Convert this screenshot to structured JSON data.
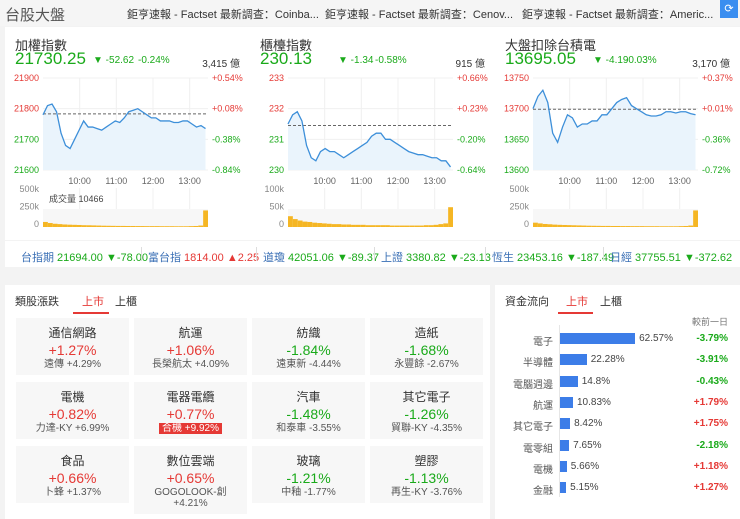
{
  "header": {
    "title": "台股大盤",
    "news": [
      "鉅亨速報 - Factset 最新調查：Coinba...",
      "鉅亨速報 - Factset 最新調查：Cenov...",
      "鉅亨速報 - Factset 最新調查：Americ..."
    ],
    "refresh_icon": "refresh-icon"
  },
  "indices": [
    {
      "name": "加權指數",
      "price": "21730.25",
      "change": "▼ -52.62",
      "pct": "-0.24%",
      "volume": "3,415 億"
    },
    {
      "name": "櫃檯指數",
      "price": "230.13",
      "change": "▼ -1.34",
      "pct": "-0.58%",
      "volume": "915 億"
    },
    {
      "name": "大盤扣除台積電",
      "price": "13695.05",
      "change": "▼ -4.19",
      "pct": "-0.03%",
      "volume": "3,170 億"
    }
  ],
  "chart_data": [
    {
      "type": "line",
      "title": "加權指數",
      "ylim": [
        21600,
        21900
      ],
      "yticks": [
        "21900",
        "21800",
        "21700",
        "21600"
      ],
      "pct_ticks": [
        "+0.54%",
        "+0.08%",
        "-0.38%",
        "-0.84%"
      ],
      "xticks": [
        "10:00",
        "11:00",
        "12:00",
        "13:00"
      ],
      "reference": 21783,
      "values": [
        21780,
        21810,
        21815,
        21790,
        21720,
        21680,
        21670,
        21700,
        21730,
        21760,
        21740,
        21740,
        21735,
        21730,
        21740,
        21750,
        21760,
        21755,
        21770,
        21790,
        21795,
        21800,
        21790,
        21780,
        21770,
        21770,
        21760,
        21760,
        21760,
        21755,
        21755,
        21760,
        21760,
        21750,
        21740,
        21745,
        21735
      ],
      "volume_label": "成交量 10466",
      "volume_ticks": [
        "500k",
        "250k",
        "0"
      ],
      "volume_max": 500,
      "volume": [
        70,
        55,
        45,
        40,
        35,
        32,
        30,
        28,
        25,
        24,
        22,
        20,
        18,
        17,
        16,
        15,
        15,
        14,
        14,
        13,
        13,
        12,
        12,
        12,
        11,
        11,
        11,
        10,
        10,
        10,
        12,
        14,
        20,
        230
      ]
    },
    {
      "type": "line",
      "title": "櫃檯指數",
      "ylim": [
        230,
        233
      ],
      "yticks": [
        "233",
        "232",
        "231",
        "230"
      ],
      "pct_ticks": [
        "+0.66%",
        "+0.23%",
        "-0.20%",
        "-0.64%"
      ],
      "xticks": [
        "10:00",
        "11:00",
        "12:00",
        "13:00"
      ],
      "reference": 231.45,
      "values": [
        231.5,
        231.8,
        231.9,
        231.6,
        230.8,
        230.4,
        230.3,
        230.6,
        230.7,
        230.6,
        230.6,
        230.5,
        230.4,
        230.5,
        230.6,
        230.7,
        230.8,
        230.9,
        231.1,
        231.2,
        231.2,
        231.0,
        231.0,
        230.9,
        230.8,
        230.7,
        230.6,
        230.55,
        230.5,
        230.5,
        230.45,
        230.4,
        230.4,
        230.3,
        230.3,
        230.1
      ],
      "volume_ticks": [
        "100k",
        "50k",
        "0"
      ],
      "volume_max": 100,
      "volume": [
        30,
        22,
        18,
        15,
        14,
        12,
        11,
        10,
        9,
        8,
        8,
        7,
        7,
        6,
        6,
        6,
        5,
        5,
        5,
        5,
        5,
        4,
        4,
        4,
        4,
        4,
        4,
        4,
        5,
        5,
        6,
        8,
        10,
        55
      ]
    },
    {
      "type": "line",
      "title": "大盤扣除台積電",
      "ylim": [
        13600,
        13750
      ],
      "yticks": [
        "13750",
        "13700",
        "13650",
        "13600"
      ],
      "pct_ticks": [
        "+0.37%",
        "+0.01%",
        "-0.36%",
        "-0.72%"
      ],
      "xticks": [
        "10:00",
        "11:00",
        "12:00",
        "13:00"
      ],
      "reference": 13699,
      "values": [
        13700,
        13720,
        13730,
        13710,
        13660,
        13645,
        13670,
        13690,
        13685,
        13670,
        13675,
        13675,
        13680,
        13680,
        13690,
        13690,
        13700,
        13710,
        13715,
        13718,
        13705,
        13700,
        13695,
        13690,
        13688,
        13688,
        13690,
        13695,
        13695,
        13693,
        13695,
        13695,
        13692,
        13690
      ],
      "volume_ticks": [
        "500k",
        "250k",
        "0"
      ],
      "volume_max": 500,
      "volume": [
        60,
        50,
        42,
        38,
        33,
        30,
        28,
        26,
        24,
        22,
        20,
        18,
        17,
        16,
        15,
        15,
        14,
        14,
        13,
        13,
        12,
        12,
        12,
        11,
        11,
        11,
        10,
        10,
        10,
        10,
        12,
        14,
        20,
        230
      ]
    }
  ],
  "ticker": [
    {
      "label": "台指期",
      "value": "21694.00",
      "change": "▼-78.00",
      "dir": "down"
    },
    {
      "label": "富台指",
      "value": "1814.00",
      "change": "▲2.25",
      "dir": "up"
    },
    {
      "label": "道瓊",
      "value": "42051.06",
      "change": "▼-89.37",
      "dir": "down"
    },
    {
      "label": "上證",
      "value": "3380.82",
      "change": "▼-23.13",
      "dir": "down"
    },
    {
      "label": "恆生",
      "value": "23453.16",
      "change": "▼-187.49",
      "dir": "down"
    },
    {
      "label": "日經",
      "value": "37755.51",
      "change": "▼-372.62",
      "dir": "down"
    }
  ],
  "sectors": {
    "title": "類股漲跌",
    "tabs": [
      "上市",
      "上櫃"
    ],
    "items": [
      {
        "name": "通信網路",
        "pct": "+1.27%",
        "stock": "遠傳 +4.29%",
        "dir": "up"
      },
      {
        "name": "航運",
        "pct": "+1.06%",
        "stock": "長榮航太 +4.09%",
        "dir": "up"
      },
      {
        "name": "紡織",
        "pct": "-1.84%",
        "stock": "遠東新 -4.44%",
        "dir": "down"
      },
      {
        "name": "造紙",
        "pct": "-1.68%",
        "stock": "永豐餘 -2.67%",
        "dir": "down"
      },
      {
        "name": "電機",
        "pct": "+0.82%",
        "stock": "力達-KY +6.99%",
        "dir": "up"
      },
      {
        "name": "電器電纜",
        "pct": "+0.77%",
        "stock": "合機 +9.92%",
        "dir": "up",
        "highlight": true
      },
      {
        "name": "汽車",
        "pct": "-1.48%",
        "stock": "和泰車 -3.55%",
        "dir": "down"
      },
      {
        "name": "其它電子",
        "pct": "-1.26%",
        "stock": "貿聯-KY -4.35%",
        "dir": "down"
      },
      {
        "name": "食品",
        "pct": "+0.66%",
        "stock": "卜蜂 +1.37%",
        "dir": "up"
      },
      {
        "name": "數位雲端",
        "pct": "+0.65%",
        "stock": "GOGOLOOK-創 +4.21%",
        "dir": "up"
      },
      {
        "name": "玻璃",
        "pct": "-1.21%",
        "stock": "中釉 -1.77%",
        "dir": "down"
      },
      {
        "name": "塑膠",
        "pct": "-1.13%",
        "stock": "再生-KY -3.76%",
        "dir": "down"
      }
    ]
  },
  "flow": {
    "title": "資金流向",
    "tabs": [
      "上市",
      "上櫃"
    ],
    "col_header": "較前一日",
    "items": [
      {
        "name": "電子",
        "share": 62.57,
        "share_label": "62.57%",
        "delta": "-3.79%",
        "dir": "down"
      },
      {
        "name": "半導體",
        "share": 22.28,
        "share_label": "22.28%",
        "delta": "-3.91%",
        "dir": "down"
      },
      {
        "name": "電腦週邊",
        "share": 14.8,
        "share_label": "14.8%",
        "delta": "-0.43%",
        "dir": "down"
      },
      {
        "name": "航運",
        "share": 10.83,
        "share_label": "10.83%",
        "delta": "+1.79%",
        "dir": "up"
      },
      {
        "name": "其它電子",
        "share": 8.42,
        "share_label": "8.42%",
        "delta": "+1.75%",
        "dir": "up"
      },
      {
        "name": "電零組",
        "share": 7.65,
        "share_label": "7.65%",
        "delta": "-2.18%",
        "dir": "down"
      },
      {
        "name": "電機",
        "share": 5.66,
        "share_label": "5.66%",
        "delta": "+1.18%",
        "dir": "up"
      },
      {
        "name": "金融",
        "share": 5.15,
        "share_label": "5.15%",
        "delta": "+1.27%",
        "dir": "up"
      }
    ]
  },
  "colors": {
    "up": "#e53935",
    "down": "#1aaa1a",
    "line": "#3d8fd9",
    "volume": "#f5b624",
    "accent": "#3a8ef0"
  }
}
